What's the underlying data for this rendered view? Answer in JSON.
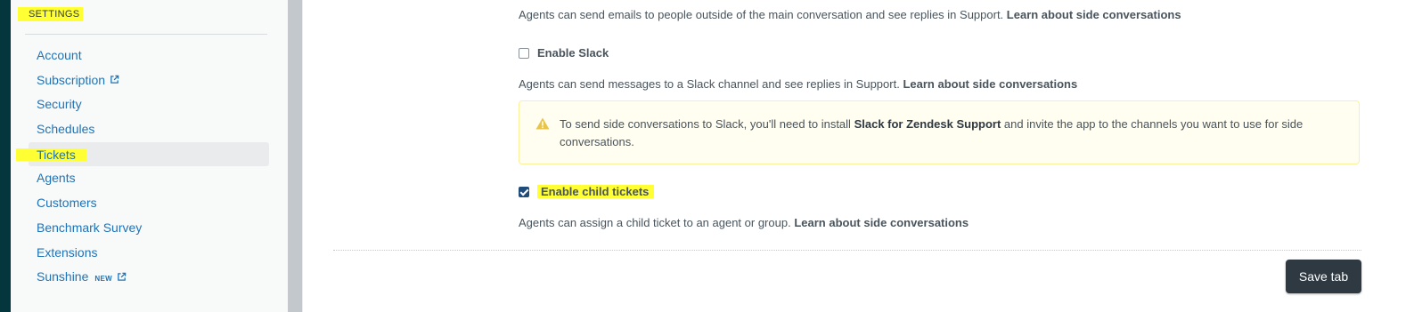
{
  "sidebar": {
    "heading": "SETTINGS",
    "items": [
      {
        "label": "Account",
        "external": false
      },
      {
        "label": "Subscription",
        "external": true
      },
      {
        "label": "Security",
        "external": false
      },
      {
        "label": "Schedules",
        "external": false
      },
      {
        "label": "Tickets",
        "external": false,
        "active": true
      },
      {
        "label": "Agents",
        "external": false
      },
      {
        "label": "Customers",
        "external": false
      },
      {
        "label": "Benchmark Survey",
        "external": false
      },
      {
        "label": "Extensions",
        "external": false
      },
      {
        "label": "Sunshine",
        "badge": "NEW",
        "external": true
      }
    ]
  },
  "main": {
    "email_desc": "Agents can send emails to people outside of the main conversation and see replies in Support.",
    "email_link": "Learn about side conversations",
    "slack_label": "Enable Slack",
    "slack_checked": false,
    "slack_desc": "Agents can send messages to a Slack channel and see replies in Support.",
    "slack_link": "Learn about side conversations",
    "notice": {
      "prefix": "To send side conversations to Slack, you'll need to install",
      "bold": "Slack for Zendesk Support",
      "suffix": "and invite the app to the channels you want to use for side conversations."
    },
    "child_label": "Enable child tickets",
    "child_checked": true,
    "child_desc": "Agents can assign a child ticket to an agent or group.",
    "child_link": "Learn about side conversations",
    "save_label": "Save tab"
  },
  "colors": {
    "highlight": "#ffff33",
    "link": "#1f73b7",
    "rail": "#03363d",
    "button": "#2f3941"
  }
}
